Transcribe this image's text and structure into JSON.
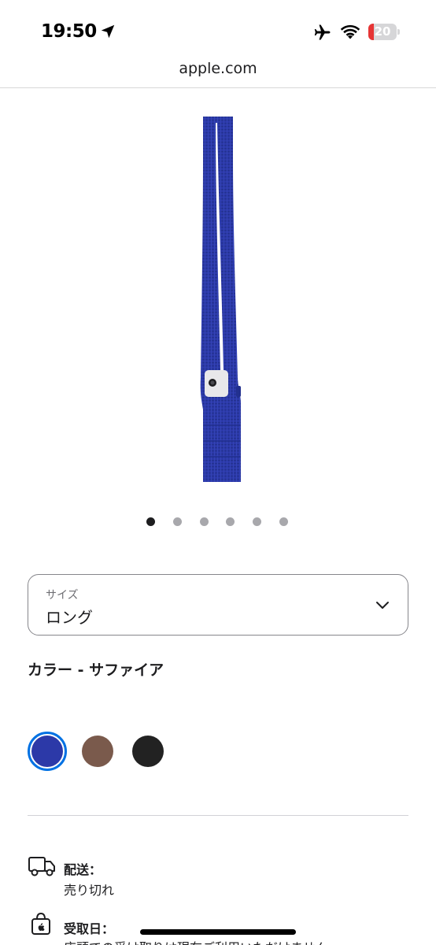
{
  "status_bar": {
    "time": "19:50",
    "battery_level": "20",
    "battery_fraction": 0.2,
    "icons": [
      "location-arrow-icon",
      "airplane-icon",
      "wifi-icon",
      "battery-icon"
    ]
  },
  "url_bar": {
    "domain": "apple.com"
  },
  "product": {
    "image_icon": "sapphire-knit-crossbody-strap",
    "carousel": {
      "count": 6,
      "active_index": 0
    }
  },
  "size_selector": {
    "caption": "サイズ",
    "value": "ロング"
  },
  "color": {
    "label": "カラー - サファイア",
    "swatches": [
      {
        "name": "sapphire",
        "color": "#2c39a8",
        "selected": true
      },
      {
        "name": "brown",
        "color": "#7a5a4c",
        "selected": false
      },
      {
        "name": "black",
        "color": "#222222",
        "selected": false
      }
    ]
  },
  "delivery": {
    "title": "配送：",
    "status": "売り切れ"
  },
  "pickup": {
    "title": "受取日：",
    "status": "店頭での受け取りは現在ご利用いただけません"
  },
  "colors": {
    "accent": "#0071e3",
    "battery_low": "#e63535",
    "product_blue": "#2c39a8"
  }
}
